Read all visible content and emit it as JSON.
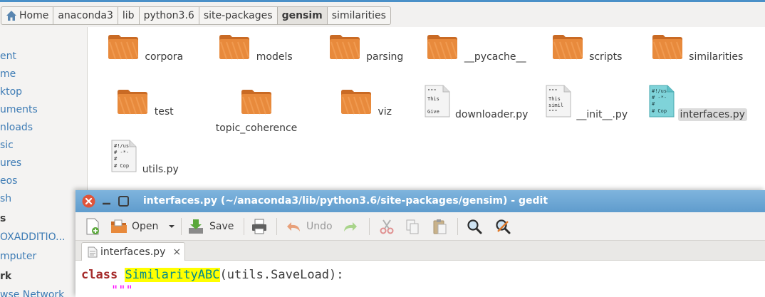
{
  "breadcrumb": {
    "items": [
      "Home",
      "anaconda3",
      "lib",
      "python3.6",
      "site-packages",
      "gensim",
      "similarities"
    ],
    "active_index": 5
  },
  "sidebar": {
    "items": [
      "ent",
      "me",
      "ktop",
      "uments",
      "nloads",
      "sic",
      "ures",
      "eos",
      "sh",
      "s",
      "OXADDITIO...",
      "mputer",
      "rk",
      "wse Network"
    ]
  },
  "files": [
    {
      "name": "corpora",
      "type": "folder"
    },
    {
      "name": "models",
      "type": "folder"
    },
    {
      "name": "parsing",
      "type": "folder"
    },
    {
      "name": "__pycache__",
      "type": "folder"
    },
    {
      "name": "scripts",
      "type": "folder"
    },
    {
      "name": "similarities",
      "type": "folder"
    },
    {
      "name": "test",
      "type": "folder"
    },
    {
      "name": "topic_coherence",
      "type": "folder"
    },
    {
      "name": "viz",
      "type": "folder"
    },
    {
      "name": "downloader.py",
      "type": "python-file",
      "preview": [
        "\"\"\"",
        "This",
        "Give"
      ]
    },
    {
      "name": "__init__.py",
      "type": "python-file",
      "preview": [
        "\"\"\"",
        "This",
        "simil",
        "\"\"\""
      ]
    },
    {
      "name": "interfaces.py",
      "type": "python-file",
      "selected": true,
      "preview": [
        "#!/us",
        "# -*-",
        "#",
        "# Cop"
      ]
    },
    {
      "name": "utils.py",
      "type": "python-file",
      "preview": [
        "#!/us",
        "# -*-",
        "#",
        "# Cop"
      ]
    }
  ],
  "gedit": {
    "title": "interfaces.py (~/anaconda3/lib/python3.6/site-packages/gensim) - gedit",
    "toolbar": {
      "open_label": "Open",
      "save_label": "Save",
      "undo_label": "Undo"
    },
    "tab_label": "interfaces.py",
    "tab_close": "×",
    "code": {
      "kw": "class",
      "classname": "SimilarityABC",
      "rest": "(utils.SaveLoad):",
      "docstring": "\"\"\""
    }
  },
  "colors": {
    "titlebar": "#5f9ccd",
    "sidebar_link": "#3e7cb5",
    "folder": "#e57f33",
    "highlight": "#ffff00"
  }
}
